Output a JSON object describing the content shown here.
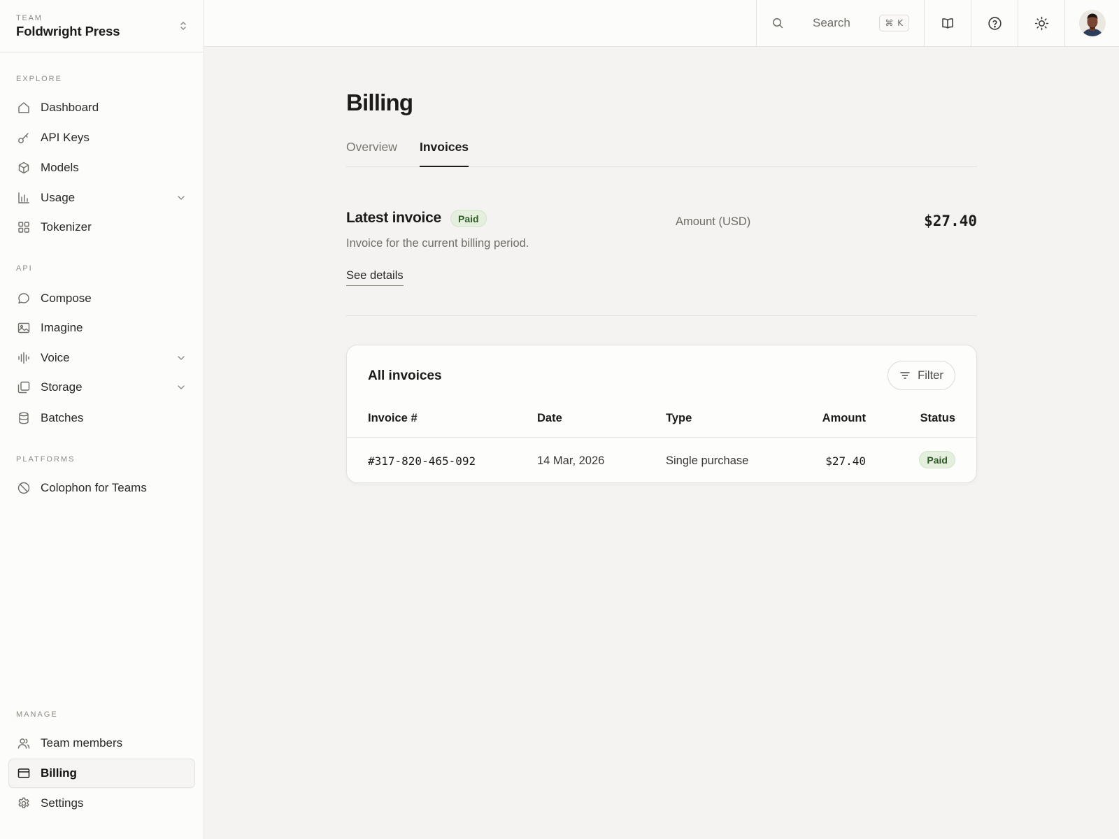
{
  "sidebar": {
    "team_caption": "TEAM",
    "team_name": "Foldwright Press",
    "sections": {
      "explore": "EXPLORE",
      "api": "API",
      "platforms": "PLATFORMS",
      "manage": "MANAGE"
    },
    "items": {
      "dashboard": "Dashboard",
      "api_keys": "API Keys",
      "models": "Models",
      "usage": "Usage",
      "tokenizer": "Tokenizer",
      "compose": "Compose",
      "imagine": "Imagine",
      "voice": "Voice",
      "storage": "Storage",
      "batches": "Batches",
      "colophon": "Colophon for Teams",
      "team_members": "Team members",
      "billing": "Billing",
      "settings": "Settings"
    },
    "active_item": "Billing"
  },
  "topbar": {
    "search_label": "Search",
    "search_shortcut": "⌘ K"
  },
  "page": {
    "title": "Billing",
    "tabs": [
      "Overview",
      "Invoices"
    ],
    "active_tab": "Invoices"
  },
  "latest_invoice": {
    "title": "Latest invoice",
    "status": "Paid",
    "description": "Invoice for the current billing period.",
    "link": "See details",
    "amount_label": "Amount (USD)",
    "amount": "$27.40"
  },
  "invoices": {
    "title": "All invoices",
    "filter_label": "Filter",
    "columns": [
      "Invoice #",
      "Date",
      "Type",
      "Amount",
      "Status"
    ],
    "rows": [
      {
        "number": "#317-820-465-092",
        "date": "14 Mar, 2026",
        "type": "Single purchase",
        "amount": "$27.40",
        "status": "Paid"
      }
    ]
  },
  "colors": {
    "paid_badge_bg": "#e4efdd",
    "paid_badge_text": "#2f5a26",
    "page_bg": "#f4f3f1",
    "sidebar_bg": "#fcfcfb"
  }
}
